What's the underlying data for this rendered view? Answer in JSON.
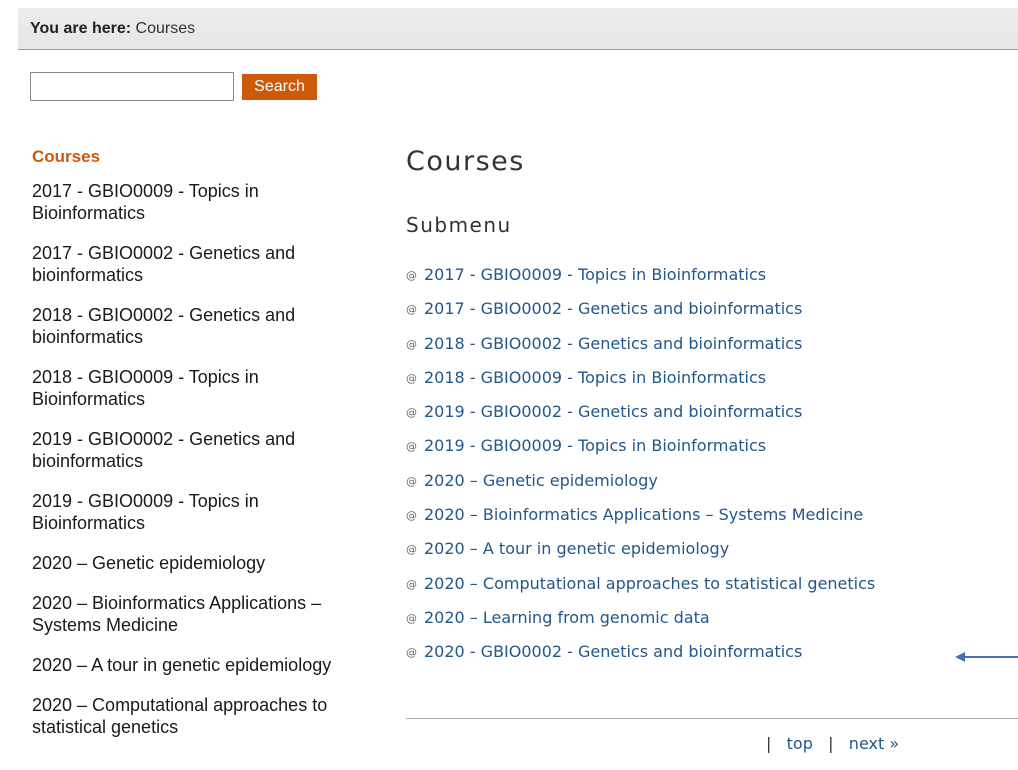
{
  "breadcrumb": {
    "prefix": "You are here:",
    "current": "Courses"
  },
  "search": {
    "value": "",
    "placeholder": "",
    "button_label": "Search"
  },
  "sidebar": {
    "title": "Courses",
    "items": [
      {
        "label": "2017 - GBIO0009 - Topics in Bioinformatics"
      },
      {
        "label": "2017 - GBIO0002 - Genetics and bioinformatics"
      },
      {
        "label": "2018 - GBIO0002 - Genetics and bioinformatics"
      },
      {
        "label": "2018 - GBIO0009 - Topics in Bioinformatics"
      },
      {
        "label": "2019 - GBIO0002 - Genetics and bioinformatics"
      },
      {
        "label": "2019 - GBIO0009 - Topics in Bioinformatics"
      },
      {
        "label": "2020 – Genetic epidemiology"
      },
      {
        "label": "2020 – Bioinformatics Applications – Systems Medicine"
      },
      {
        "label": "2020 – A tour in genetic epidemiology"
      },
      {
        "label": "2020 – Computational approaches to statistical genetics"
      }
    ]
  },
  "main": {
    "title": "Courses",
    "submenu_title": "Submenu",
    "bullet_glyph": "@",
    "submenu_items": [
      {
        "label": "2017 - GBIO0009 - Topics in Bioinformatics"
      },
      {
        "label": "2017 - GBIO0002 - Genetics and bioinformatics"
      },
      {
        "label": "2018 - GBIO0002 - Genetics and bioinformatics"
      },
      {
        "label": "2018 - GBIO0009 - Topics in Bioinformatics"
      },
      {
        "label": "2019 - GBIO0002 - Genetics and bioinformatics"
      },
      {
        "label": "2019 - GBIO0009 - Topics in Bioinformatics"
      },
      {
        "label": "2020 – Genetic epidemiology"
      },
      {
        "label": "2020 – Bioinformatics Applications – Systems Medicine"
      },
      {
        "label": "2020 – A tour in genetic epidemiology"
      },
      {
        "label": "2020 – Computational approaches to statistical genetics"
      },
      {
        "label": "2020 – Learning from genomic data"
      },
      {
        "label": "2020 - GBIO0002 - Genetics and bioinformatics"
      }
    ]
  },
  "pager": {
    "separator": "|",
    "top_label": "top",
    "next_label": "next »"
  },
  "colors": {
    "accent_orange": "#cc5a0a",
    "link_blue": "#23578c",
    "arrow_blue": "#4a72b0",
    "breadcrumb_bg": "#e8e8e8"
  },
  "icons": {
    "bullet": "at-sign-bullet-icon",
    "arrow": "left-arrow-icon"
  }
}
